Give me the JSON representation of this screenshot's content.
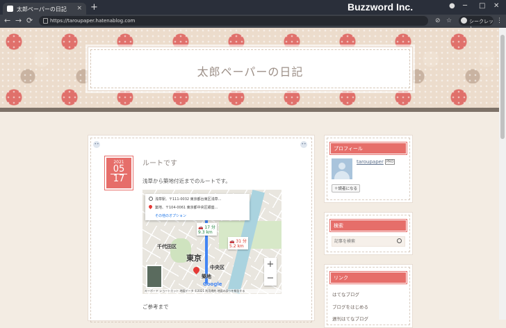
{
  "browser": {
    "tab_title": "太郎ペーパーの日記",
    "tab_close": "×",
    "new_tab": "+",
    "brand": "Buzzword Inc.",
    "url": "https://taroupaper.hatenablog.com",
    "incognito_label": "シークレット",
    "back": "←",
    "forward": "→",
    "reload": "⟳",
    "min": "─",
    "max": "□",
    "close": "✕"
  },
  "blog": {
    "title": "太郎ペーパーの日記"
  },
  "post": {
    "date": {
      "year": "2021",
      "month": "05",
      "day": "17"
    },
    "title": "ルートです",
    "intro": "浅草から築地付近までのルートです。",
    "outro": "ご参考まで"
  },
  "map": {
    "origin": "浅草駅、〒111-0032 東京都台東区浅草...",
    "destination": "築地、〒104-0061 東京都中央区銀座...",
    "options_link": "その他のオプション",
    "route1_time": "17 分",
    "route1_dist": "9.3 km",
    "route2_time": "31 分",
    "route2_dist": "5.2 km",
    "label_chiyoda": "千代田区",
    "label_tokyo": "東京",
    "label_chuo": "中央区",
    "label_tsukiji": "築地",
    "zoom_in": "+",
    "zoom_out": "−",
    "footer": "キーボード ショートカット   地図データ ©2021   利用規約   地図の誤りを報告する",
    "google": "Google"
  },
  "sidebar": {
    "profile_heading": "プロフィール",
    "profile_name": "taroupaper",
    "pro_badge": "PRO",
    "follow_label": "読者になる",
    "search_heading": "検索",
    "search_placeholder": "記事を検索",
    "links_heading": "リンク",
    "links": [
      "はてなブログ",
      "ブログをはじめる",
      "週刊はてなブログ"
    ]
  }
}
